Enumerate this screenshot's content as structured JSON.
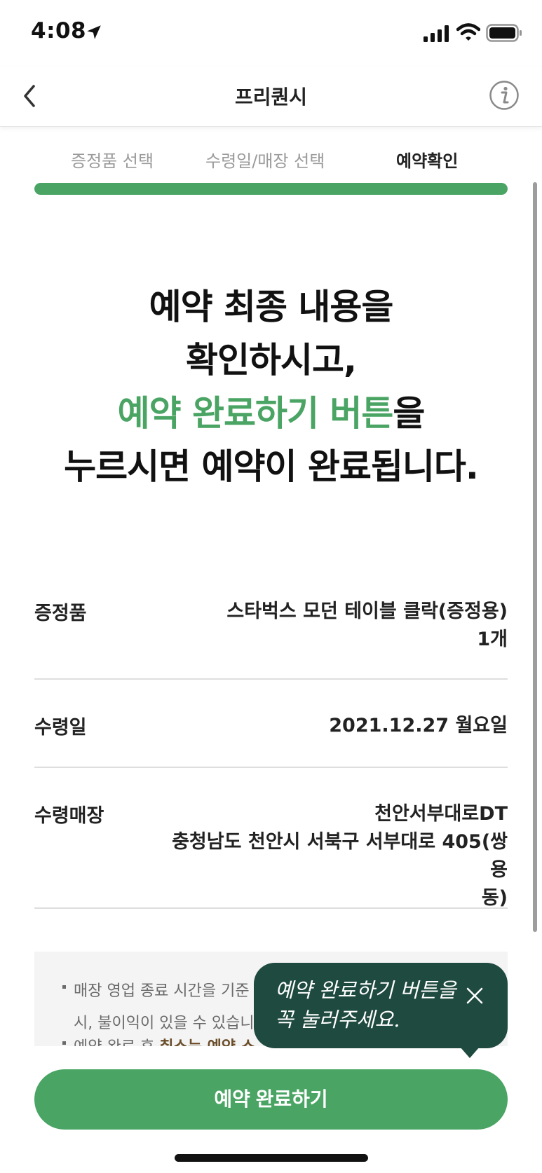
{
  "status_bar": {
    "time": "4:08"
  },
  "nav": {
    "title": "프리퀀시"
  },
  "steps": [
    {
      "label": "증정품 선택"
    },
    {
      "label": "수령일/매장 선택"
    },
    {
      "label": "예약확인"
    }
  ],
  "progress": {
    "fraction": 1.0
  },
  "headline": {
    "line1": "예약 최종 내용을",
    "line2": "확인하시고,",
    "line3_green": "예약 완료하기 버튼",
    "line3_rest": "을",
    "line4": "누르시면 예약이 완료됩니다."
  },
  "rows": {
    "gift_label": "증정품",
    "gift_value_line1": "스타벅스 모던 테이블 클락(증정용)",
    "gift_value_line2": "1개",
    "date_label": "수령일",
    "date_value": "2021.12.27 월요일",
    "store_label": "수령매장",
    "store_name": "천안서부대로DT",
    "store_address_line1": "충청남도 천안시 서북구 서부대로 405(쌍용",
    "store_address_line2": "동)"
  },
  "notice": {
    "line1": "매장 영업 종료 시간을 기준",
    "line2": "시, 불이익이 있을 수 있습니",
    "line3_prefix": "예약 완료 후 ",
    "line3_em": "취소는 예약 스"
  },
  "tooltip": {
    "line1": "예약 완료하기 버튼을",
    "line2": "꼭 눌러주세요."
  },
  "cta": {
    "label": "예약 완료하기"
  },
  "colors": {
    "accent_green": "#4aa463",
    "tooltip_bg": "#1f4a3f",
    "notice_emphasis": "#6b4e2a"
  }
}
